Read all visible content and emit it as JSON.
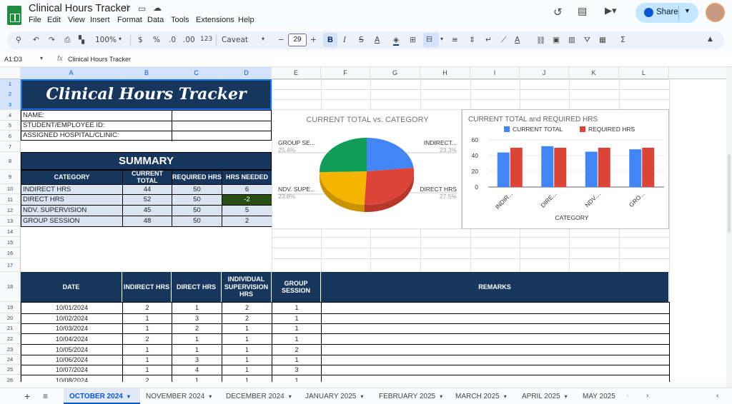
{
  "doc": {
    "title": "Clinical Hours Tracker"
  },
  "menu": [
    "File",
    "Edit",
    "View",
    "Insert",
    "Format",
    "Data",
    "Tools",
    "Extensions",
    "Help"
  ],
  "share": {
    "label": "Share"
  },
  "toolbar": {
    "zoom": "100%",
    "currency": "$",
    "percent": "%",
    "decimals": ".0",
    "decimals2": ".00",
    "number_format": "123",
    "font": "Caveat",
    "font_size": "29",
    "bold": "B",
    "italic": "I",
    "strike": "S",
    "text_color": "A",
    "sigma": "Σ"
  },
  "formula_bar": {
    "range": "A1:D3",
    "fx": "fx",
    "value": "Clinical Hours Tracker"
  },
  "columns": [
    "A",
    "B",
    "C",
    "D",
    "E",
    "F",
    "G",
    "H",
    "I",
    "J",
    "K",
    "L"
  ],
  "rows": [
    "1",
    "2",
    "3",
    "4",
    "5",
    "6",
    "7",
    "8",
    "9",
    "10",
    "11",
    "12",
    "13",
    "14",
    "15",
    "16",
    "17",
    "18",
    "19",
    "20",
    "21",
    "22",
    "23",
    "24",
    "25",
    "26"
  ],
  "banner": "Clinical Hours Tracker",
  "info": {
    "name": "NAME:",
    "id": "STUDENT/EMPLOYEE ID:",
    "hospital": "ASSIGNED HOSPITAL/CLINIC:"
  },
  "summary": {
    "title": "SUMMARY",
    "headers": [
      "CATEGORY",
      "CURRENT TOTAL",
      "REQUIRED HRS",
      "HRS NEEDED"
    ],
    "rows": [
      [
        "INDIRECT HRS",
        "44",
        "50",
        "6"
      ],
      [
        "DIRECT HRS",
        "52",
        "50",
        "-2"
      ],
      [
        "NDV. SUPERVISION",
        "45",
        "50",
        "5"
      ],
      [
        "GROUP SESSION",
        "48",
        "50",
        "2"
      ]
    ]
  },
  "log": {
    "headers": [
      "DATE",
      "INDIRECT HRS",
      "DIRECT HRS",
      "INDIVIDUAL SUPERVISION HRS",
      "GROUP SESSION",
      "REMARKS"
    ],
    "rows": [
      [
        "10/01/2024",
        "2",
        "1",
        "2",
        "1"
      ],
      [
        "10/02/2024",
        "1",
        "3",
        "2",
        "1"
      ],
      [
        "10/03/2024",
        "1",
        "2",
        "1",
        "1"
      ],
      [
        "10/04/2024",
        "2",
        "1",
        "1",
        "1"
      ],
      [
        "10/05/2024",
        "1",
        "1",
        "1",
        "2"
      ],
      [
        "10/06/2024",
        "1",
        "3",
        "1",
        "1"
      ],
      [
        "10/07/2024",
        "1",
        "4",
        "1",
        "3"
      ],
      [
        "10/08/2024",
        "2",
        "1",
        "1",
        "1"
      ]
    ]
  },
  "chart_data": [
    {
      "type": "pie",
      "title": "CURRENT TOTAL vs. CATEGORY",
      "labels": [
        "INDIRECT...",
        "DIRECT HRS",
        "NDV. SUPE...",
        "GROUP SE..."
      ],
      "values": [
        23.3,
        27.5,
        23.8,
        25.4
      ],
      "percent_labels": [
        "23.3%",
        "27.5%",
        "23.8%",
        "25.4%"
      ],
      "colors": [
        "#4285f4",
        "#db4437",
        "#f4b400",
        "#0f9d58"
      ]
    },
    {
      "type": "bar",
      "title": "CURRENT TOTAL and REQUIRED HRS",
      "categories": [
        "INDIR...",
        "DIRE...",
        "NDV....",
        "GRO..."
      ],
      "series": [
        {
          "name": "CURRENT TOTAL",
          "values": [
            44,
            52,
            45,
            48
          ],
          "color": "#4285f4"
        },
        {
          "name": "REQUIRED HRS",
          "values": [
            50,
            50,
            50,
            50
          ],
          "color": "#db4437"
        }
      ],
      "xlabel": "CATEGORY",
      "ylabel": "",
      "ylim": [
        0,
        60
      ],
      "yticks": [
        "0",
        "20",
        "40",
        "60"
      ],
      "legend": "top",
      "grid": true
    }
  ],
  "tabs": [
    "OCTOBER 2024",
    "NOVEMBER 2024",
    "DECEMBER 2024",
    "JANUARY 2025",
    "FEBRUARY 2025",
    "MARCH 2025",
    "APRIL 2025",
    "MAY 2025"
  ],
  "colors": {
    "navy": "#17365d",
    "light_blue": "#dbe5f1",
    "negative_cell": "#274e13",
    "accent": "#0b57d0"
  }
}
